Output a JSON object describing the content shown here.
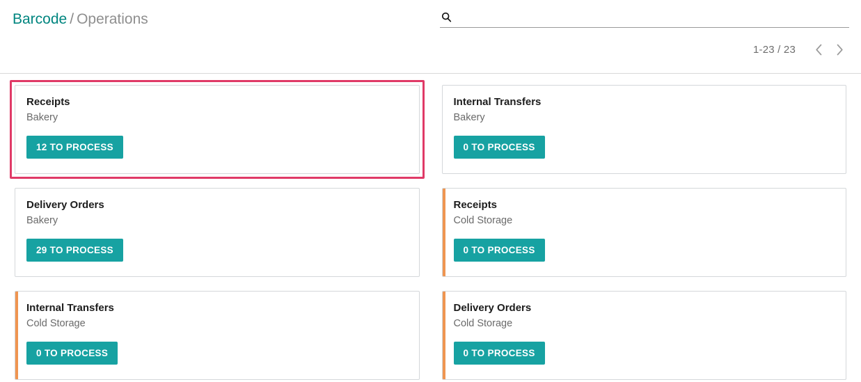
{
  "breadcrumb": {
    "root": "Barcode",
    "separator": "/",
    "current": "Operations"
  },
  "search": {
    "icon": "search-icon",
    "value": "",
    "placeholder": ""
  },
  "pager": {
    "range": "1-23 / 23",
    "prev_icon": "chevron-left-icon",
    "next_icon": "chevron-right-icon"
  },
  "colors": {
    "brand_teal": "#00857f",
    "button_teal": "#17a2a2",
    "highlight_pink": "#e03a67",
    "accent_orange": "#ef9551",
    "card_border": "#d4d7da",
    "muted_text": "#6a6a6a"
  },
  "kanban": {
    "rows": [
      [
        {
          "title": "Receipts",
          "subtitle": "Bakery",
          "button_label": "12 TO PROCESS",
          "count": 12,
          "highlighted": true,
          "accent": false
        },
        {
          "title": "Internal Transfers",
          "subtitle": "Bakery",
          "button_label": "0 TO PROCESS",
          "count": 0,
          "highlighted": false,
          "accent": false
        }
      ],
      [
        {
          "title": "Delivery Orders",
          "subtitle": "Bakery",
          "button_label": "29 TO PROCESS",
          "count": 29,
          "highlighted": false,
          "accent": false
        },
        {
          "title": "Receipts",
          "subtitle": "Cold Storage",
          "button_label": "0 TO PROCESS",
          "count": 0,
          "highlighted": false,
          "accent": true
        }
      ],
      [
        {
          "title": "Internal Transfers",
          "subtitle": "Cold Storage",
          "button_label": "0 TO PROCESS",
          "count": 0,
          "highlighted": false,
          "accent": true
        },
        {
          "title": "Delivery Orders",
          "subtitle": "Cold Storage",
          "button_label": "0 TO PROCESS",
          "count": 0,
          "highlighted": false,
          "accent": true
        }
      ]
    ]
  }
}
